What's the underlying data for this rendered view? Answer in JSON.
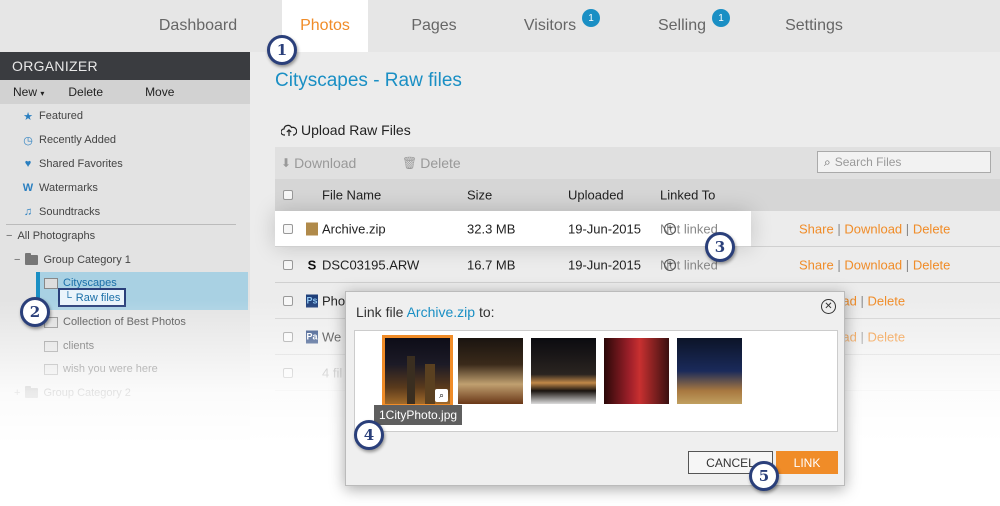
{
  "nav": {
    "tabs": [
      {
        "label": "Dashboard",
        "badge": null
      },
      {
        "label": "Photos",
        "badge": null
      },
      {
        "label": "Pages",
        "badge": null
      },
      {
        "label": "Visitors",
        "badge": "1"
      },
      {
        "label": "Selling",
        "badge": "1"
      },
      {
        "label": "Settings",
        "badge": null
      }
    ],
    "active_tab": "Photos"
  },
  "sidebar": {
    "header": "ORGANIZER",
    "actions": {
      "new": "New",
      "delete": "Delete",
      "move": "Move"
    },
    "items": [
      {
        "label": "Featured",
        "icon": "star-icon"
      },
      {
        "label": "Recently Added",
        "icon": "clock-icon"
      },
      {
        "label": "Shared Favorites",
        "icon": "heart-icon"
      },
      {
        "label": "Watermarks",
        "icon": "watermark-icon"
      },
      {
        "label": "Soundtracks",
        "icon": "music-icon"
      }
    ],
    "tree": {
      "root": "All Photographs",
      "group1": "Group Category 1",
      "cityscapes": "Cityscapes",
      "raw_files": "Raw files",
      "best": "Collection of Best Photos",
      "clients": "clients",
      "wish": "wish you were here",
      "group2": "Group Category 2"
    }
  },
  "main": {
    "title": "Cityscapes - Raw files",
    "upload_label": "Upload Raw Files",
    "download_label": "Download",
    "delete_label": "Delete",
    "search_placeholder": "Search Files",
    "columns": {
      "file_name": "File Name",
      "size": "Size",
      "uploaded": "Uploaded",
      "linked_to": "Linked To"
    },
    "rows": [
      {
        "name": "Archive.zip",
        "size": "32.3 MB",
        "uploaded": "19-Jun-2015",
        "linked": "Not linked",
        "type": "zip"
      },
      {
        "name": "DSC03195.ARW",
        "size": "16.7 MB",
        "uploaded": "19-Jun-2015",
        "linked": "Not linked",
        "type": "sony"
      },
      {
        "name": "Pho",
        "type": "ps"
      },
      {
        "name": "We",
        "type": "pa"
      }
    ],
    "footer_count": "4 fil",
    "actions": {
      "share": "Share",
      "download": "Download",
      "delete": "Delete",
      "sep": "|"
    }
  },
  "dialog": {
    "title_prefix": "Link file ",
    "file_name": "Archive.zip",
    "title_suffix": " to:",
    "selected_caption": "1CityPhoto.jpg",
    "cancel_label": "CANCEL",
    "link_label": "LINK"
  },
  "steps": [
    "1",
    "2",
    "3",
    "4",
    "5"
  ],
  "colors": {
    "accent": "#f08c28",
    "link_blue": "#1a8fc4",
    "callout": "#2a3f7a"
  }
}
